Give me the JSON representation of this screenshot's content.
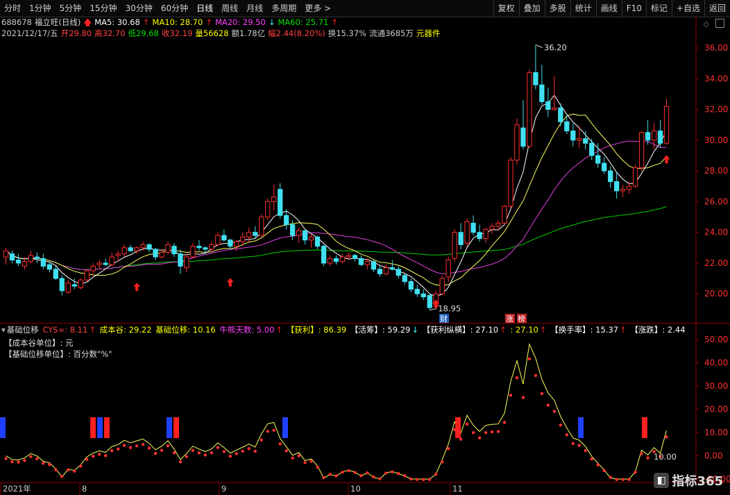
{
  "toolbar": {
    "periods": [
      "分时",
      "1分钟",
      "5分钟",
      "15分钟",
      "30分钟",
      "60分钟",
      "日线",
      "周线",
      "月线",
      "多周期",
      "更多 >"
    ],
    "active": "日线",
    "right_buttons": [
      "复权",
      "叠加",
      "多股",
      "统计",
      "画线",
      "F10",
      "标记",
      "+自选",
      "返回"
    ]
  },
  "stock": {
    "code": "688678",
    "name_period": "福立旺(日线)",
    "ma5": "MA5: 30.68",
    "ma10": "MA10: 28.70",
    "ma20": "MA20: 29.50",
    "ma60": "MA60: 25.71",
    "date": "2021/12/17/五",
    "open": "开29.80",
    "high": "高32.70",
    "low": "低29.68",
    "close": "收32.19",
    "volume": "量56628",
    "amount": "额1.78亿",
    "change": "幅2.44(8.20%)",
    "turnover": "换15.37%",
    "float": "流通3685万",
    "sector": "元器件"
  },
  "price_chart": {
    "high_label": "36.20",
    "low_label": "18.95",
    "y_ticks": [
      "36.00",
      "34.00",
      "32.00",
      "30.00",
      "28.00",
      "26.00",
      "24.00",
      "22.00",
      "20.00"
    ],
    "badges": [
      "财",
      "涨",
      "榜"
    ]
  },
  "indicator": {
    "name": "基础位移",
    "cys": "CYS∞: 8.11",
    "cost_valley": "成本谷: 29.22",
    "base_shift": "基础位移: 10.16",
    "bull_bear": "牛熊天数: 5.00",
    "profit": "【获利】: 86.39",
    "active_chips": "【活筹】: 59.29",
    "profit_span": "【获利纵横】: 27.10",
    "profit_span2": ": 27.10",
    "turnover": "【换手率】: 15.37",
    "rise": "【涨跌】: 2.44",
    "note1": "【成本谷单位】: 元",
    "note2": "【基础位移单位】: 百分数\"%\"",
    "y_ticks": [
      "50.00",
      "40.00",
      "30.00",
      "20.00",
      "10.00",
      "0.00",
      "-10.00"
    ],
    "extra_label": "10.00"
  },
  "x_axis": {
    "labels": [
      "2021年",
      "8",
      "9",
      "10",
      "11"
    ]
  },
  "watermark": "指标365",
  "chart_data": {
    "type": "candlestick",
    "ylim": [
      19,
      36.5
    ],
    "candles": [
      [
        22.4,
        23.0,
        21.9,
        22.8
      ],
      [
        22.6,
        22.8,
        22.0,
        22.2
      ],
      [
        22.2,
        22.6,
        21.8,
        22.0
      ],
      [
        21.8,
        22.4,
        21.6,
        22.1
      ],
      [
        22.1,
        22.8,
        22.0,
        22.5
      ],
      [
        22.4,
        22.7,
        22.0,
        22.3
      ],
      [
        22.3,
        22.6,
        21.6,
        21.8
      ],
      [
        21.9,
        22.1,
        21.4,
        21.6
      ],
      [
        21.6,
        21.8,
        20.9,
        21.0
      ],
      [
        21.0,
        21.2,
        19.9,
        20.2
      ],
      [
        20.1,
        20.9,
        20.0,
        20.7
      ],
      [
        20.6,
        21.0,
        20.3,
        20.5
      ],
      [
        20.4,
        21.0,
        20.3,
        20.9
      ],
      [
        20.9,
        21.6,
        20.8,
        21.5
      ],
      [
        21.5,
        22.0,
        21.2,
        21.8
      ],
      [
        21.9,
        22.2,
        21.6,
        22.0
      ],
      [
        22.0,
        22.3,
        21.8,
        21.9
      ],
      [
        21.9,
        22.7,
        21.8,
        22.4
      ],
      [
        22.5,
        22.8,
        22.1,
        22.6
      ],
      [
        22.6,
        23.2,
        22.4,
        23.0
      ],
      [
        23.0,
        23.2,
        22.7,
        22.8
      ],
      [
        22.8,
        23.1,
        22.6,
        23.0
      ],
      [
        23.0,
        23.4,
        22.8,
        23.2
      ],
      [
        23.2,
        23.3,
        22.7,
        22.9
      ],
      [
        22.9,
        23.0,
        22.2,
        22.4
      ],
      [
        22.4,
        22.9,
        22.3,
        22.7
      ],
      [
        22.7,
        23.4,
        22.6,
        23.2
      ],
      [
        23.1,
        23.3,
        22.4,
        22.6
      ],
      [
        22.6,
        22.9,
        21.3,
        21.8
      ],
      [
        21.7,
        22.6,
        21.4,
        22.4
      ],
      [
        22.4,
        23.3,
        22.3,
        23.1
      ],
      [
        23.1,
        23.5,
        22.8,
        23.0
      ],
      [
        23.0,
        23.1,
        22.6,
        22.9
      ],
      [
        22.9,
        23.4,
        22.7,
        23.2
      ],
      [
        23.2,
        24.0,
        23.1,
        23.8
      ],
      [
        23.8,
        24.2,
        23.4,
        23.5
      ],
      [
        23.5,
        23.6,
        22.9,
        23.1
      ],
      [
        23.1,
        23.5,
        22.8,
        23.4
      ],
      [
        23.4,
        24.0,
        23.1,
        23.7
      ],
      [
        23.7,
        24.3,
        23.4,
        24.0
      ],
      [
        24.0,
        24.4,
        23.6,
        23.8
      ],
      [
        23.8,
        25.2,
        23.7,
        25.0
      ],
      [
        25.0,
        26.2,
        24.8,
        26.0
      ],
      [
        26.0,
        27.1,
        25.4,
        26.3
      ],
      [
        26.8,
        27.2,
        24.9,
        25.1
      ],
      [
        25.1,
        25.5,
        24.2,
        24.5
      ],
      [
        24.5,
        24.8,
        23.5,
        23.8
      ],
      [
        23.8,
        24.3,
        23.3,
        24.1
      ],
      [
        24.1,
        24.2,
        23.2,
        23.5
      ],
      [
        23.5,
        23.9,
        23.0,
        23.7
      ],
      [
        23.7,
        23.8,
        22.9,
        23.1
      ],
      [
        23.1,
        23.2,
        21.8,
        22.0
      ],
      [
        22.0,
        22.5,
        21.8,
        22.3
      ],
      [
        22.3,
        22.5,
        21.9,
        22.1
      ],
      [
        22.1,
        22.6,
        22.0,
        22.4
      ],
      [
        22.4,
        22.7,
        22.2,
        22.5
      ],
      [
        22.5,
        22.6,
        22.1,
        22.3
      ],
      [
        22.3,
        22.5,
        21.8,
        21.9
      ],
      [
        21.9,
        22.3,
        21.6,
        22.1
      ],
      [
        22.1,
        22.2,
        21.4,
        21.6
      ],
      [
        21.6,
        21.8,
        21.1,
        21.3
      ],
      [
        21.3,
        21.9,
        21.2,
        21.7
      ],
      [
        21.7,
        22.2,
        21.5,
        21.6
      ],
      [
        21.6,
        21.8,
        21.0,
        21.2
      ],
      [
        21.2,
        21.3,
        20.6,
        20.8
      ],
      [
        20.8,
        21.0,
        20.1,
        20.3
      ],
      [
        20.3,
        20.6,
        19.8,
        20.0
      ],
      [
        20.0,
        20.3,
        19.6,
        19.8
      ],
      [
        19.9,
        19.95,
        18.95,
        19.1
      ],
      [
        19.2,
        20.2,
        19.1,
        20.0
      ],
      [
        20.0,
        21.2,
        19.9,
        21.0
      ],
      [
        21.1,
        22.4,
        20.8,
        22.2
      ],
      [
        22.3,
        24.2,
        22.1,
        24.0
      ],
      [
        24.0,
        24.6,
        22.9,
        23.2
      ],
      [
        23.3,
        24.9,
        23.1,
        24.7
      ],
      [
        24.6,
        25.1,
        23.8,
        24.0
      ],
      [
        24.0,
        24.5,
        23.4,
        23.6
      ],
      [
        23.6,
        24.3,
        23.3,
        24.2
      ],
      [
        24.2,
        24.6,
        23.9,
        24.4
      ],
      [
        24.4,
        24.8,
        24.1,
        24.6
      ],
      [
        24.6,
        25.8,
        24.5,
        25.7
      ],
      [
        25.7,
        28.9,
        25.6,
        28.7
      ],
      [
        28.7,
        31.4,
        28.4,
        31.0
      ],
      [
        30.8,
        32.6,
        29.4,
        29.6
      ],
      [
        29.6,
        34.6,
        29.5,
        34.4
      ],
      [
        34.4,
        36.2,
        33.3,
        33.6
      ],
      [
        33.6,
        34.9,
        32.3,
        32.5
      ],
      [
        32.5,
        33.4,
        31.5,
        32.0
      ],
      [
        32.0,
        34.2,
        31.9,
        32.1
      ],
      [
        32.1,
        32.4,
        30.9,
        31.2
      ],
      [
        31.2,
        31.6,
        30.4,
        30.6
      ],
      [
        30.6,
        31.1,
        29.6,
        30.0
      ],
      [
        30.0,
        30.9,
        29.5,
        30.1
      ],
      [
        30.1,
        30.6,
        29.4,
        29.8
      ],
      [
        29.8,
        30.1,
        28.7,
        29.0
      ],
      [
        29.0,
        29.8,
        28.2,
        28.5
      ],
      [
        28.5,
        28.9,
        27.8,
        28.0
      ],
      [
        28.0,
        28.3,
        26.9,
        27.3
      ],
      [
        27.3,
        27.9,
        26.2,
        26.7
      ],
      [
        26.7,
        27.1,
        26.3,
        26.8
      ],
      [
        26.8,
        27.3,
        26.5,
        27.0
      ],
      [
        27.0,
        28.4,
        26.9,
        28.2
      ],
      [
        28.2,
        30.6,
        28.0,
        30.5
      ],
      [
        30.5,
        31.3,
        29.7,
        30.0
      ],
      [
        30.0,
        31.1,
        29.4,
        30.6
      ],
      [
        30.6,
        31.3,
        29.5,
        29.8
      ],
      [
        29.8,
        32.7,
        29.7,
        32.2
      ]
    ]
  }
}
